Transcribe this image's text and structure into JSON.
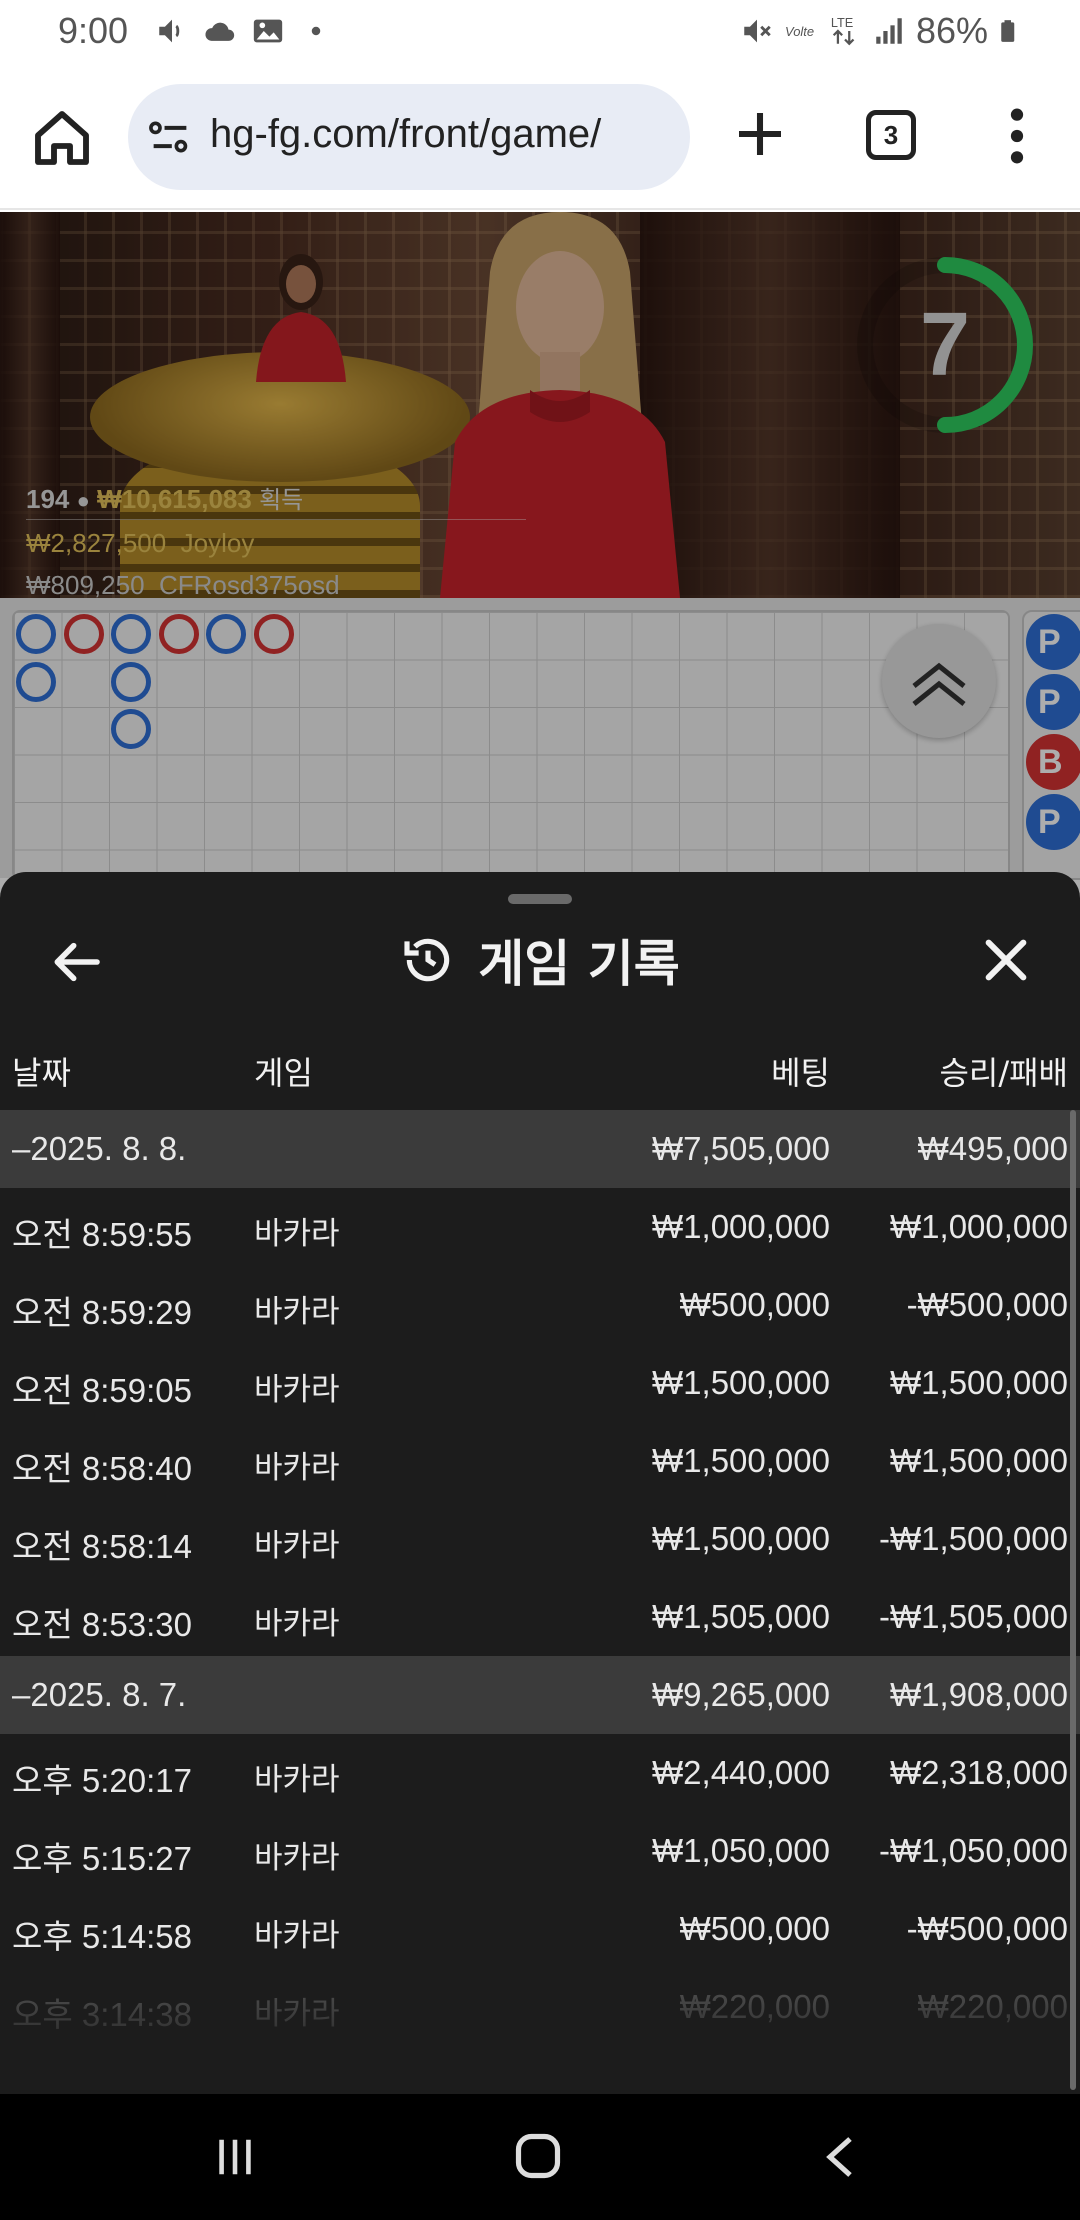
{
  "status": {
    "time": "9:00",
    "battery": "86%"
  },
  "browser": {
    "url": "hg-fg.com/front/game/",
    "tab_count": "3"
  },
  "video": {
    "timer": "7",
    "info": {
      "players": "194",
      "won_amount": "₩10,615,083",
      "won_label": "획득",
      "top_bet_1_amount": "₩2,827,500",
      "top_bet_1_user": "Joyloy",
      "top_bet_2_amount": "₩809,250",
      "top_bet_2_user": "CFRosd375osd"
    }
  },
  "road": {
    "columns": [
      [
        "P",
        "P"
      ],
      [
        "B"
      ],
      [
        "P",
        "P",
        "P"
      ],
      [
        "B"
      ],
      [
        "P"
      ],
      [
        "B"
      ]
    ],
    "side_badges": [
      "P",
      "P",
      "B",
      "P"
    ],
    "colors": {
      "player": "#2e6fd6",
      "banker": "#d43333"
    }
  },
  "sheet": {
    "title": "게임 기록",
    "columns": {
      "date": "날짜",
      "game": "게임",
      "bet": "베팅",
      "win_loss": "승리/패배"
    },
    "rows": [
      {
        "type": "group",
        "date": "–2025. 8. 8.",
        "game": "",
        "bet": "₩7,505,000",
        "win": "₩495,000"
      },
      {
        "type": "item",
        "date": "오전 8:59:55",
        "game": "바카라",
        "bet": "₩1,000,000",
        "win": "₩1,000,000"
      },
      {
        "type": "item",
        "date": "오전 8:59:29",
        "game": "바카라",
        "bet": "₩500,000",
        "win": "-₩500,000"
      },
      {
        "type": "item",
        "date": "오전 8:59:05",
        "game": "바카라",
        "bet": "₩1,500,000",
        "win": "₩1,500,000"
      },
      {
        "type": "item",
        "date": "오전 8:58:40",
        "game": "바카라",
        "bet": "₩1,500,000",
        "win": "₩1,500,000"
      },
      {
        "type": "item",
        "date": "오전 8:58:14",
        "game": "바카라",
        "bet": "₩1,500,000",
        "win": "-₩1,500,000"
      },
      {
        "type": "item",
        "date": "오전 8:53:30",
        "game": "바카라",
        "bet": "₩1,505,000",
        "win": "-₩1,505,000"
      },
      {
        "type": "group",
        "date": "–2025. 8. 7.",
        "game": "",
        "bet": "₩9,265,000",
        "win": "₩1,908,000"
      },
      {
        "type": "item",
        "date": "오후 5:20:17",
        "game": "바카라",
        "bet": "₩2,440,000",
        "win": "₩2,318,000"
      },
      {
        "type": "item",
        "date": "오후 5:15:27",
        "game": "바카라",
        "bet": "₩1,050,000",
        "win": "-₩1,050,000"
      },
      {
        "type": "item",
        "date": "오후 5:14:58",
        "game": "바카라",
        "bet": "₩500,000",
        "win": "-₩500,000"
      },
      {
        "type": "item faded",
        "date": "오후 3:14:38",
        "game": "바카라",
        "bet": "₩220,000",
        "win": "₩220,000"
      }
    ]
  }
}
